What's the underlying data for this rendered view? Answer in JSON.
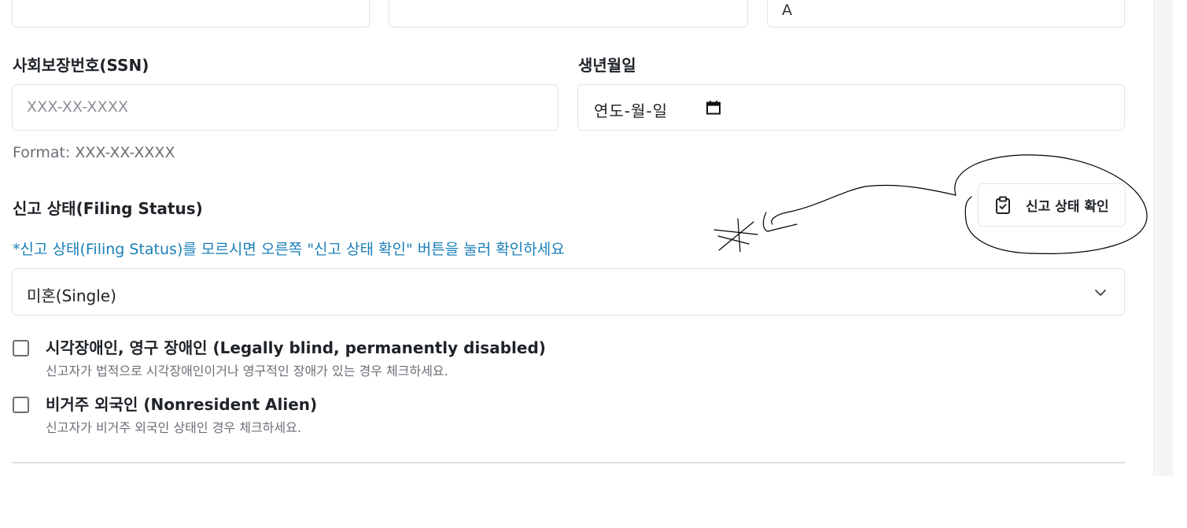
{
  "top_fields": {
    "third_value": "A"
  },
  "ssn": {
    "label": "사회보장번호(SSN)",
    "placeholder": "XXX-XX-XXXX",
    "help": "Format: XXX-XX-XXXX"
  },
  "birthdate": {
    "label": "생년월일",
    "value": "연도-월-일",
    "icon": "calendar-icon"
  },
  "filing_status": {
    "label": "신고 상태(Filing Status)",
    "info": "*신고 상태(Filing Status)를 모르시면 오른쪽 \"신고 상태 확인\" 버튼을 눌러 확인하세요",
    "check_button_label": "신고 상태 확인",
    "check_button_icon": "clipboard-check-icon",
    "selected": "미혼(Single)",
    "select_icon": "chevron-down-icon"
  },
  "options": [
    {
      "title": "시각장애인, 영구 장애인 (Legally blind, permanently disabled)",
      "description": "신고자가 법적으로 시각장애인이거나 영구적인 장애가 있는 경우 체크하세요.",
      "checked": false
    },
    {
      "title": "비거주 외국인 (Nonresident Alien)",
      "description": "신고자가 비거주 외국인 상태인 경우 체크하세요.",
      "checked": false
    }
  ],
  "colors": {
    "accent_link": "#1a7fb8",
    "border": "#e1e4e8",
    "muted_text": "#6a6f76"
  }
}
